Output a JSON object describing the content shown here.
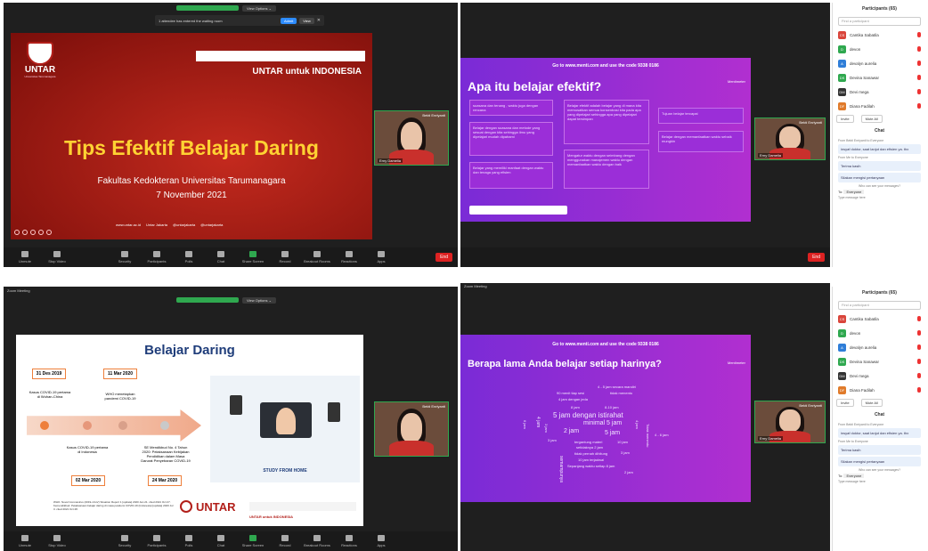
{
  "q1": {
    "waiting_notice": "1 attendee has entered the waiting room",
    "admit": "Admit",
    "view": "View",
    "slide_logo_text": "UNTAR",
    "slide_logo_sub": "Universitas Tarumanagara",
    "slide_brand": "UNTAR untuk INDONESIA",
    "slide_title": "Tips Efektif Belajar Daring",
    "slide_org": "Fakultas Kedokteran Universitas Tarumanagara",
    "slide_date": "7 November 2021",
    "footer_links": [
      "www.untar.ac.id",
      "Untar Jakarta",
      "@untarjakarta",
      "@untarjakarta"
    ],
    "cam_name": "Erny Damelia",
    "cam_top": "Bekti Enriyanti"
  },
  "toolbar": {
    "items": [
      "Unmute",
      "Stop Video",
      "Security",
      "Participants",
      "Polls",
      "Chat",
      "Share Screen",
      "Record",
      "Breakout Rooms",
      "Reactions",
      "Apps"
    ],
    "participants_count": "65",
    "end": "End"
  },
  "q2": {
    "menti_banner": "Go to www.menti.com and use the code 9338 0186",
    "menti_logo": "Mentimeter",
    "question": "Apa itu belajar efektif?",
    "cards": [
      "suasana dan tenang , waktu juga dengan rencana",
      "Belajar dengan suasana dan metode yang sesuai dengan kita sehingga ilmu yang dipelajari mudah dipahami",
      "Belajar yang memiliki manfaat dengan waktu dan tenaga yang efisien",
      "Belajar efektif adalah belajar yang di mana kita memusatkan semua konsentrasi kita pada apa yang dipelajari sehingga apa yang dipelajari dapat tersimpan",
      "Mengatur waktu dengan seimbang dengan menggunakan manajemen waktu dengan memanfaatkan waktu dengan baik",
      "Tujuan belajar tercapai",
      "Belajar dengan memanfaatkan waktu sebaik mungkin"
    ],
    "cam_name": "Erny Damelia",
    "cam_top": "Bekti Enriyanti"
  },
  "side": {
    "title": "Participants (65)",
    "search_placeholder": "Find a participant",
    "participants": [
      {
        "initials": "CS",
        "name": "Cantika Sabatila",
        "color": "#d9453b"
      },
      {
        "initials": "D",
        "name": "devon",
        "color": "#2fa84f"
      },
      {
        "initials": "A",
        "name": "devalyn aurelia",
        "color": "#2f7ed8"
      },
      {
        "initials": "DS",
        "name": "Devina Sanawar",
        "color": "#2fa84f"
      },
      {
        "initials": "DM",
        "name": "Devi mega",
        "color": "#333333"
      },
      {
        "initials": "DF",
        "name": "Diana Fadilah",
        "color": "#e07b2b"
      }
    ],
    "invite": "Invite",
    "mute_all": "Mute All",
    "chat_title": "Chat",
    "chat_meta1": "From Bekti Enriyanti to Everyone",
    "chat_msg1": "insyaf doktor, saat lanjut dan efisien ya. thx",
    "chat_meta2": "From Me to Everyone",
    "chat_msg2": "Terima kasih",
    "chat_msg3": "Silakan mengisi pertanyaan",
    "chat_placeholder": "Who can see your messages?",
    "to_label": "To:",
    "to_value": "Everyone",
    "type_placeholder": "Type message here"
  },
  "q3": {
    "title": "Zoom Meeting",
    "slide_title": "Belajar Daring",
    "timeline": [
      {
        "date": "31 Des 2019",
        "text": "Kasus COVID-19 pertama di Wuhan-China"
      },
      {
        "date": "11 Mar 2020",
        "text": "WHO menetapkan pandemi COVID-19"
      },
      {
        "date": "02 Mar 2020",
        "text": "Kasus COVID-19 pertama di Indonesia"
      },
      {
        "date": "24 Mar 2020",
        "text": "SE Mendikbud No. 4 Tahun 2020: Pelaksanaan Kebijakan Pendidikan dalam Masa Darurat Penyebaran COVID-19"
      }
    ],
    "study_label": "STUDY FROM HOME",
    "untar": "UNTAR",
    "untar_sub": "UNTAR untuk INDONESIA",
    "refs": "WHO. Novel Coronavirus (2019-nCoV) Situation Report 1 [update] 2020 Jan 21. cited 2021 Oct 27. Kemendikbud. Pelaksanaan belajar daring di masa pandemi COVID-19 (Indonesia) [update] 2020 Jul 3. cited 2021 Oct 28.",
    "cam_top": "Bekti Enriyanti"
  },
  "q4": {
    "title": "Zoom Meeting",
    "menti_banner": "Go to www.menti.com and use the code 9338 0186",
    "menti_logo": "Mentimeter",
    "question": "Berapa lama Anda belajar setiap harinya?",
    "words": [
      "4 - 5 jam secara mandiri",
      "90 menit tiap sesi",
      "4 jam dengan jeda",
      "tidak menentu",
      "8 jam",
      "8-10 jam",
      "5 jam dengan istirahat",
      "minimal 5 jam",
      "2 jam",
      "3 jam",
      "5 jam",
      "tergantung materi",
      "setidaknya 2 jam",
      "tidak pernah dihitung",
      "10 jam",
      "10 jam terjadwal",
      "Sepanjang waktu setiap 8 jam",
      "2 jam",
      "3 jam",
      "4 jam",
      "semampunya",
      "Tidak menentu",
      "6 jam",
      "4 jam",
      "4 - 6 jam",
      "3 jam"
    ],
    "cam_top": "Bekti Enriyanti",
    "cam_name": "Erny Damelia"
  }
}
